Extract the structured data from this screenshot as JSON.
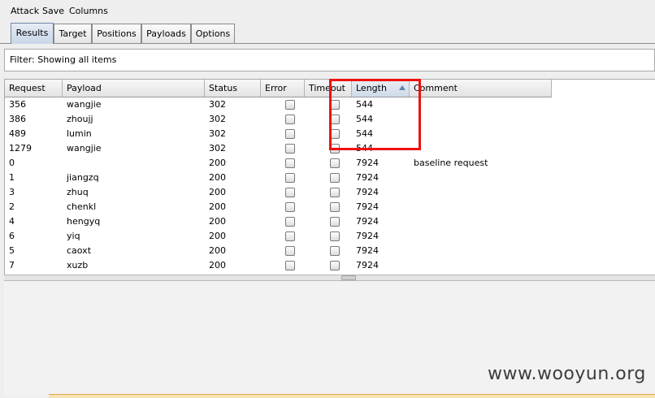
{
  "menu": [
    "Attack",
    "Save",
    "Columns"
  ],
  "tabs": [
    {
      "label": "Results",
      "active": true
    },
    {
      "label": "Target",
      "active": false
    },
    {
      "label": "Positions",
      "active": false
    },
    {
      "label": "Payloads",
      "active": false
    },
    {
      "label": "Options",
      "active": false
    }
  ],
  "filter": {
    "text": "Filter:  Showing all items"
  },
  "columns": [
    "Request",
    "Payload",
    "Status",
    "Error",
    "Timeout",
    "Length",
    "Comment"
  ],
  "sorted_column": "Length",
  "rows": [
    {
      "request": "356",
      "payload": "wangjie",
      "status": "302",
      "error": false,
      "timeout": false,
      "length": "544",
      "comment": ""
    },
    {
      "request": "386",
      "payload": "zhoujj",
      "status": "302",
      "error": false,
      "timeout": false,
      "length": "544",
      "comment": ""
    },
    {
      "request": "489",
      "payload": "lumin",
      "status": "302",
      "error": false,
      "timeout": false,
      "length": "544",
      "comment": ""
    },
    {
      "request": "1279",
      "payload": "wangjie",
      "status": "302",
      "error": false,
      "timeout": false,
      "length": "544",
      "comment": ""
    },
    {
      "request": "0",
      "payload": "",
      "status": "200",
      "error": false,
      "timeout": false,
      "length": "7924",
      "comment": "baseline request"
    },
    {
      "request": "1",
      "payload": "jiangzq",
      "status": "200",
      "error": false,
      "timeout": false,
      "length": "7924",
      "comment": ""
    },
    {
      "request": "3",
      "payload": "zhuq",
      "status": "200",
      "error": false,
      "timeout": false,
      "length": "7924",
      "comment": ""
    },
    {
      "request": "2",
      "payload": "chenkl",
      "status": "200",
      "error": false,
      "timeout": false,
      "length": "7924",
      "comment": ""
    },
    {
      "request": "4",
      "payload": "hengyq",
      "status": "200",
      "error": false,
      "timeout": false,
      "length": "7924",
      "comment": ""
    },
    {
      "request": "6",
      "payload": "yiq",
      "status": "200",
      "error": false,
      "timeout": false,
      "length": "7924",
      "comment": ""
    },
    {
      "request": "5",
      "payload": "caoxt",
      "status": "200",
      "error": false,
      "timeout": false,
      "length": "7924",
      "comment": ""
    },
    {
      "request": "7",
      "payload": "xuzb",
      "status": "200",
      "error": false,
      "timeout": false,
      "length": "7924",
      "comment": ""
    }
  ],
  "watermark": "www.wooyun.org",
  "colors": {
    "highlight": "#ee1111",
    "active_tab": "#c8d6e8",
    "sort_arrow": "#6183ad"
  }
}
